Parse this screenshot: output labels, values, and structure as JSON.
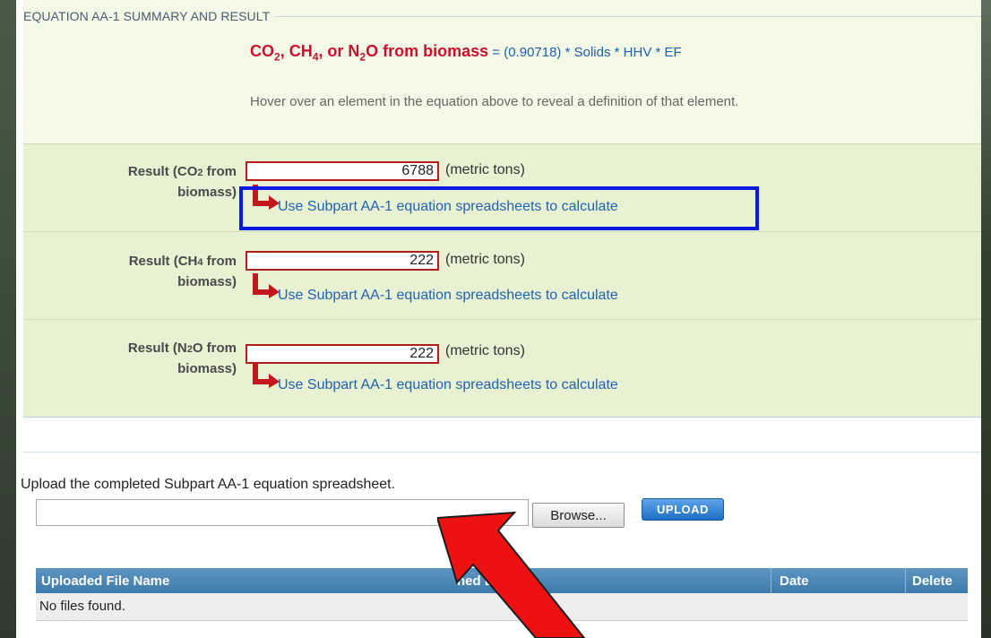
{
  "fieldset": {
    "legend": "EQUATION AA-1 SUMMARY AND RESULT"
  },
  "equation": {
    "left": {
      "prefix": "CO",
      "sub1": "2",
      "mid1": ", CH",
      "sub2": "4",
      "mid2": ", or N",
      "sub3": "2",
      "suffix": "O from biomass"
    },
    "equals": " = ",
    "factor": "(0.90718)",
    "op": " * ",
    "terms": [
      "Solids",
      "HHV",
      "EF"
    ]
  },
  "hint": "Hover over an element in the equation above to reveal a definition of that element.",
  "results": [
    {
      "label_a": "Result (CO",
      "label_sub": "2",
      "label_b": " from",
      "label_c": "biomass)",
      "value": "6788",
      "units": "(metric tons)",
      "link": "Use Subpart AA-1 equation spreadsheets to calculate"
    },
    {
      "label_a": "Result (CH",
      "label_sub": "4",
      "label_b": " from",
      "label_c": "biomass)",
      "value": "222",
      "units": "(metric tons)",
      "link": "Use Subpart AA-1 equation spreadsheets to calculate"
    },
    {
      "label_a": "Result (N",
      "label_sub": "2",
      "label_b": "O from",
      "label_c": "biomass)",
      "value": "222",
      "units": "(metric tons)",
      "link": "Use Subpart AA-1 equation spreadsheets to calculate"
    }
  ],
  "upload": {
    "instructions": "Upload the completed Subpart AA-1 equation spreadsheet.",
    "file_value": "",
    "browse_label": "Browse...",
    "upload_label": "UPLOAD"
  },
  "table": {
    "columns": [
      "Uploaded File Name",
      "hed By",
      "Date",
      "Delete"
    ],
    "empty_message": "No files found."
  },
  "colors": {
    "highlight_box": "#0a18e6",
    "annotation_arrow": "#ee1111",
    "result_border": "#b01e1e",
    "link": "#1f63b2"
  }
}
